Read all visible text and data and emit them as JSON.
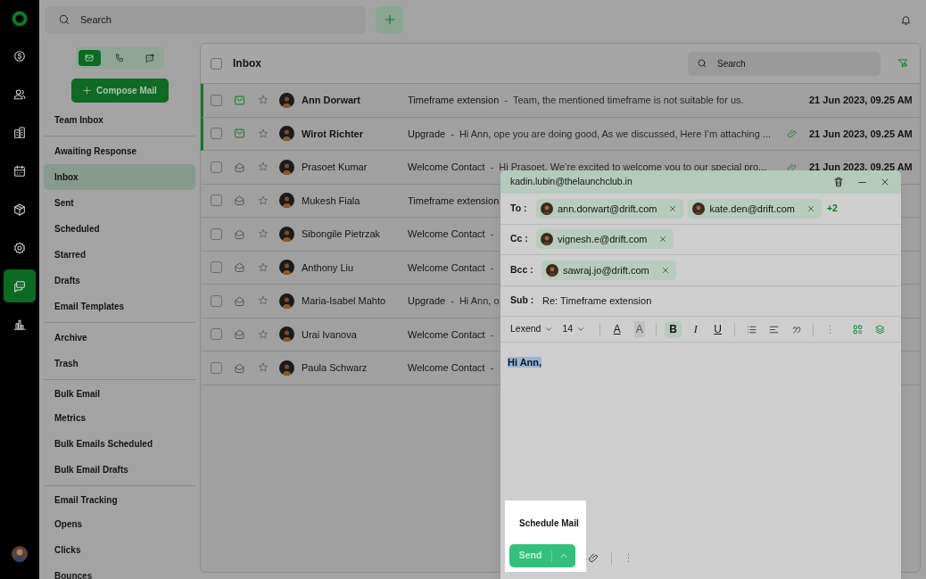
{
  "rail": {
    "items": [
      {
        "kind": "deals",
        "selected": false
      },
      {
        "kind": "contacts",
        "selected": false
      },
      {
        "kind": "companies",
        "selected": false
      },
      {
        "kind": "calendar",
        "selected": false
      },
      {
        "kind": "products",
        "selected": false
      },
      {
        "kind": "settings",
        "selected": false
      },
      {
        "kind": "messages",
        "selected": true
      },
      {
        "kind": "reports",
        "selected": false
      }
    ]
  },
  "top_bar": {
    "search": {
      "placeholder": "Search"
    }
  },
  "channels": [
    {
      "kind": "mail",
      "selected": true
    },
    {
      "kind": "phone",
      "selected": false
    },
    {
      "kind": "chat",
      "selected": false
    }
  ],
  "compose_button": "Compose Mail",
  "folder_groups": [
    {
      "items": [
        {
          "label": "Team Inbox",
          "kind": "item",
          "selected": false
        }
      ]
    },
    {
      "items": [
        {
          "label": "Awaiting Response",
          "kind": "item",
          "selected": false
        },
        {
          "label": "Inbox",
          "kind": "item",
          "selected": true
        },
        {
          "label": "Sent",
          "kind": "item",
          "selected": false
        },
        {
          "label": "Scheduled",
          "kind": "item",
          "selected": false
        },
        {
          "label": "Starred",
          "kind": "item",
          "selected": false
        },
        {
          "label": "Drafts",
          "kind": "item",
          "selected": false
        },
        {
          "label": "Email Templates",
          "kind": "item",
          "selected": false
        }
      ]
    },
    {
      "items": [
        {
          "label": "Archive",
          "kind": "item",
          "selected": false
        },
        {
          "label": "Trash",
          "kind": "item",
          "selected": false
        }
      ]
    },
    {
      "items": [
        {
          "label": "Bulk Email",
          "kind": "heading",
          "selected": false
        },
        {
          "label": "Metrics",
          "kind": "item",
          "selected": false
        },
        {
          "label": "Bulk Emails Scheduled",
          "kind": "item",
          "selected": false
        },
        {
          "label": "Bulk Email Drafts",
          "kind": "item",
          "selected": false
        }
      ]
    },
    {
      "items": [
        {
          "label": "Email Tracking",
          "kind": "heading",
          "selected": false
        },
        {
          "label": "Opens",
          "kind": "item",
          "selected": false
        },
        {
          "label": "Clicks",
          "kind": "item",
          "selected": false
        },
        {
          "label": "Bounces",
          "kind": "item",
          "selected": false
        }
      ]
    }
  ],
  "inbox": {
    "title": "Inbox",
    "all_checked": false,
    "search": {
      "placeholder": "Search"
    },
    "rows": [
      {
        "sender": "Ann Dorwart",
        "checked": false,
        "unread": true,
        "starred": false,
        "subject": "Timeframe extension",
        "separator": "-",
        "preview": "Team, the mentioned timeframe is not suitable for us.",
        "attachment": false,
        "date": "21 Jun 2023, 09.25 AM"
      },
      {
        "sender": "Wirot Richter",
        "checked": false,
        "unread": true,
        "starred": false,
        "subject": "Upgrade",
        "separator": "-",
        "preview": "Hi Ann, ope you are doing good, As we discussed, Here I’m attaching ...",
        "attachment": true,
        "date": "21 Jun 2023, 09.25 AM"
      },
      {
        "sender": "Prasoet Kumar",
        "checked": false,
        "unread": false,
        "starred": false,
        "subject": "Welcome Contact",
        "separator": "-",
        "preview": "Hi Prasoet, We’re excited to welcome you to our special pro...",
        "attachment": true,
        "date": "21 Jun 2023, 09.25 AM"
      },
      {
        "sender": "Mukesh Fiala",
        "checked": false,
        "unread": false,
        "starred": false,
        "subject": "Timeframe extension"
      },
      {
        "sender": "Sibongile Pietrzak",
        "checked": false,
        "unread": false,
        "starred": false,
        "subject": "Welcome Contact",
        "separator": "-"
      },
      {
        "sender": "Anthony Liu",
        "checked": false,
        "unread": false,
        "starred": false,
        "subject": "Welcome Contact",
        "separator": "-"
      },
      {
        "sender": "Maria-Isabel Mahto",
        "checked": false,
        "unread": false,
        "starred": false,
        "subject": "Upgrade",
        "separator": "-",
        "preview": "Hi Ann, o"
      },
      {
        "sender": "Urai Ivanova",
        "checked": false,
        "unread": false,
        "starred": false,
        "subject": "Welcome Contact",
        "separator": "-"
      },
      {
        "sender": "Paula Schwarz",
        "checked": false,
        "unread": false,
        "starred": false,
        "subject": "Welcome Contact",
        "separator": "-"
      }
    ]
  },
  "composer": {
    "from": "kadin.lubin@thelaunchclub.in",
    "fields": [
      {
        "label": "To :",
        "kind": "recipients",
        "chips": [
          "ann.dorwart@drift.com",
          "kate.den@drift.com"
        ],
        "more": "+2"
      },
      {
        "label": "Cc :",
        "kind": "recipients",
        "chips": [
          "vignesh.e@drift.com"
        ]
      },
      {
        "label": "Bcc :",
        "kind": "recipients",
        "chips": [
          "sawraj.jo@drift.com"
        ]
      },
      {
        "label": "Sub :",
        "kind": "text",
        "value": "Re: Timeframe extension"
      }
    ],
    "toolbar": [
      {
        "kind": "dropdown",
        "label": "Lexend"
      },
      {
        "kind": "dropdown",
        "label": "14"
      },
      {
        "kind": "divider"
      },
      {
        "kind": "text-color",
        "label": "A",
        "selected": false
      },
      {
        "kind": "highlight",
        "label": "A",
        "selected": false
      },
      {
        "kind": "divider"
      },
      {
        "kind": "bold",
        "label": "B",
        "selected": true
      },
      {
        "kind": "italic",
        "label": "I",
        "selected": false
      },
      {
        "kind": "underline",
        "label": "U",
        "selected": false
      },
      {
        "kind": "divider"
      },
      {
        "kind": "bullets"
      },
      {
        "kind": "align"
      },
      {
        "kind": "quote"
      },
      {
        "kind": "divider"
      },
      {
        "kind": "more"
      },
      {
        "kind": "spacer"
      },
      {
        "kind": "grid"
      },
      {
        "kind": "layers"
      }
    ],
    "body": {
      "text": "Hi Ann,",
      "selected": true
    },
    "send_menu": {
      "items": [
        "Schedule Mail"
      ],
      "send": "Send"
    }
  }
}
